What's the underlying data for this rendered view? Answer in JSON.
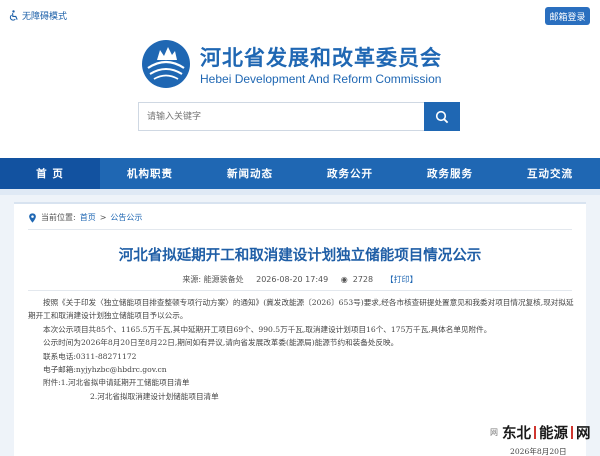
{
  "topbar": {
    "accessibility_label": "无障碍模式",
    "mail_login_label": "邮箱登录"
  },
  "brand": {
    "name_cn": "河北省发展和改革委员会",
    "name_en": "Hebei Development And Reform Commission"
  },
  "search": {
    "placeholder": "请输入关键字"
  },
  "nav": {
    "items": [
      "首 页",
      "机构职责",
      "新闻动态",
      "政务公开",
      "政务服务",
      "互动交流"
    ]
  },
  "breadcrumb": {
    "prefix": "当前位置:",
    "home": "首页",
    "sep": ">",
    "section": "公告公示"
  },
  "article": {
    "title": "河北省拟延期开工和取消建设计划独立储能项目情况公示",
    "source": "来源: 能源装备处",
    "datetime": "2026-08-20 17:49",
    "views": "2728",
    "print_label": "【打印】",
    "paragraphs": [
      "按照《关于印发〈独立储能项目排查整顿专项行动方案〉的通知》(冀发改能源〔2026〕653号)要求,经各市核查研提处置意见和我委对项目情况复核,现对拟延期开工和取消建设计划独立储能项目予以公示。",
      "本次公示项目共85个、1165.5万千瓦,其中延期开工项目69个、990.5万千瓦,取消建设计划项目16个、175万千瓦,具体名单见附件。",
      "公示时间为2026年8月20日至8月22日,期间如有异议,请向省发展改革委(能源局)能源节约和装备处反映。",
      "联系电话:0311-88271172",
      "电子邮箱:nyjyhzbc@hbdrc.gov.cn",
      "附件:1.河北省拟申请延期开工储能项目清单"
    ],
    "attachment_2": "2.河北省拟取消建设计划储能项目清单",
    "footer_date": "2026年8月20日"
  },
  "watermark": {
    "mark": "网",
    "text_a": "东北",
    "text_b": "能源",
    "text_c": "网"
  },
  "colors": {
    "primary": "#1f67b3",
    "nav_active": "#1252a0",
    "title": "#1f5ea6"
  }
}
